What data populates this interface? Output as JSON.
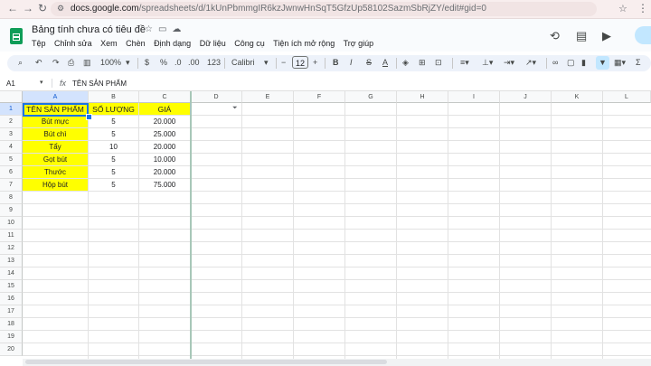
{
  "browser": {
    "url_host": "docs.google.com",
    "url_path": "/spreadsheets/d/1kUnPbmmgIR6kzJwnwHnSqT5GfzUp58102SazmSbRjZY/edit#gid=0",
    "back_icon": "arrow-left-icon",
    "forward_icon": "arrow-right-icon",
    "reload_icon": "reload-icon"
  },
  "doc": {
    "title": "Bảng tính chưa có tiêu đề"
  },
  "menu": {
    "items": [
      "Tệp",
      "Chỉnh sửa",
      "Xem",
      "Chèn",
      "Định dạng",
      "Dữ liệu",
      "Công cụ",
      "Tiện ích mở rộng",
      "Trợ giúp"
    ]
  },
  "toolbar": {
    "zoom": "100%",
    "currency": "$",
    "percent": "%",
    "dec_decrease": ".0",
    "dec_increase": ".00",
    "number_format": "123",
    "font": "Calibri",
    "font_size": "12",
    "bold": "B",
    "text_color": "A"
  },
  "formula_bar": {
    "cell_ref": "A1",
    "fx": "fx",
    "value": "TÊN SẢN PHẨM"
  },
  "grid": {
    "columns": [
      "A",
      "B",
      "C",
      "D",
      "E",
      "F",
      "G",
      "H",
      "I",
      "J",
      "K",
      "L"
    ],
    "rows": [
      "1",
      "2",
      "3",
      "4",
      "5",
      "6",
      "7",
      "8",
      "9",
      "10",
      "11",
      "12",
      "13",
      "14",
      "15",
      "16",
      "17",
      "18",
      "19",
      "20"
    ],
    "header_row": [
      "TÊN SẢN PHẨM",
      "SỐ LƯỢNG",
      "GIÁ"
    ],
    "data_rows": [
      [
        "Bút mực",
        "5",
        "20.000"
      ],
      [
        "Bút chì",
        "5",
        "25.000"
      ],
      [
        "Tẩy",
        "10",
        "20.000"
      ],
      [
        "Gọt bút",
        "5",
        "10.000"
      ],
      [
        "Thước",
        "5",
        "20.000"
      ],
      [
        "Hộp bút",
        "5",
        "75.000"
      ]
    ],
    "highlight_color": "#ffff00",
    "selection_color": "#1a73e8"
  }
}
